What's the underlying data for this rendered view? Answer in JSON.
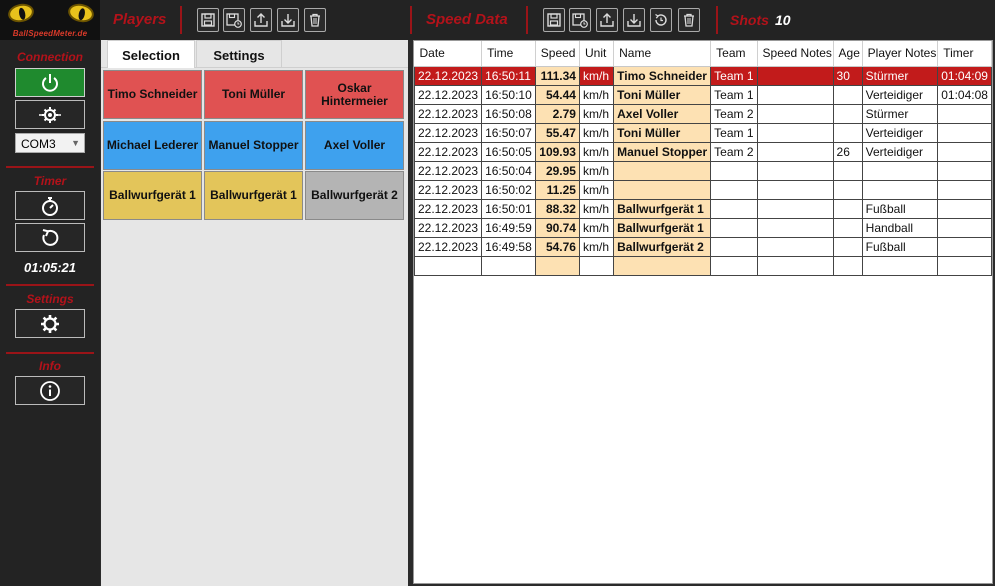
{
  "logo": {
    "text": "BallSpeedMeter.de"
  },
  "header": {
    "players_title": "Players",
    "speed_title": "Speed Data",
    "shots_label": "Shots",
    "shots_value": "10"
  },
  "sidebar": {
    "connection_label": "Connection",
    "port": "COM3",
    "timer_label": "Timer",
    "timer_value": "01:05:21",
    "settings_label": "Settings",
    "info_label": "Info"
  },
  "players": {
    "tabs": [
      "Selection",
      "Settings"
    ],
    "buttons": [
      {
        "label": "Timo Schneider",
        "color": "#e05252"
      },
      {
        "label": "Toni Müller",
        "color": "#e05252"
      },
      {
        "label": "Oskar Hintermeier",
        "color": "#e05252"
      },
      {
        "label": "Michael Lederer",
        "color": "#3ea1ee"
      },
      {
        "label": "Manuel Stopper",
        "color": "#3ea1ee"
      },
      {
        "label": "Axel Voller",
        "color": "#3ea1ee"
      },
      {
        "label": "Ballwurfgerät 1",
        "color": "#e3c55a"
      },
      {
        "label": "Ballwurfgerät 1",
        "color": "#e3c55a"
      },
      {
        "label": "Ballwurfgerät 2",
        "color": "#b4b4b4"
      }
    ]
  },
  "speed_table": {
    "columns": [
      "Date",
      "Time",
      "Speed",
      "Unit",
      "Name",
      "Team",
      "Speed Notes",
      "Age",
      "Player Notes",
      "Timer"
    ],
    "rows": [
      [
        "22.12.2023",
        "16:50:11",
        "111.34",
        "km/h",
        "Timo Schneider",
        "Team 1",
        "",
        "30",
        "Stürmer",
        "01:04:09"
      ],
      [
        "22.12.2023",
        "16:50:10",
        "54.44",
        "km/h",
        "Toni Müller",
        "Team 1",
        "",
        "",
        "Verteidiger",
        "01:04:08"
      ],
      [
        "22.12.2023",
        "16:50:08",
        "2.79",
        "km/h",
        "Axel Voller",
        "Team 2",
        "",
        "",
        "Stürmer",
        ""
      ],
      [
        "22.12.2023",
        "16:50:07",
        "55.47",
        "km/h",
        "Toni Müller",
        "Team 1",
        "",
        "",
        "Verteidiger",
        ""
      ],
      [
        "22.12.2023",
        "16:50:05",
        "109.93",
        "km/h",
        "Manuel Stopper",
        "Team 2",
        "",
        "26",
        "Verteidiger",
        ""
      ],
      [
        "22.12.2023",
        "16:50:04",
        "29.95",
        "km/h",
        "",
        "",
        "",
        "",
        "",
        ""
      ],
      [
        "22.12.2023",
        "16:50:02",
        "11.25",
        "km/h",
        "",
        "",
        "",
        "",
        "",
        ""
      ],
      [
        "22.12.2023",
        "16:50:01",
        "88.32",
        "km/h",
        "Ballwurfgerät 1",
        "",
        "",
        "",
        "Fußball",
        ""
      ],
      [
        "22.12.2023",
        "16:49:59",
        "90.74",
        "km/h",
        "Ballwurfgerät 1",
        "",
        "",
        "",
        "Handball",
        ""
      ],
      [
        "22.12.2023",
        "16:49:58",
        "54.76",
        "km/h",
        "Ballwurfgerät 2",
        "",
        "",
        "",
        "Fußball",
        ""
      ],
      [
        "",
        "",
        "",
        "",
        "",
        "",
        "",
        "",
        "",
        ""
      ]
    ],
    "selected_row": 0
  },
  "colors": {
    "accent_red": "#b3121a",
    "selected_row": "#c21b1b",
    "highlight_cell": "#fde1b3",
    "connect_green": "#1f8a2e"
  }
}
